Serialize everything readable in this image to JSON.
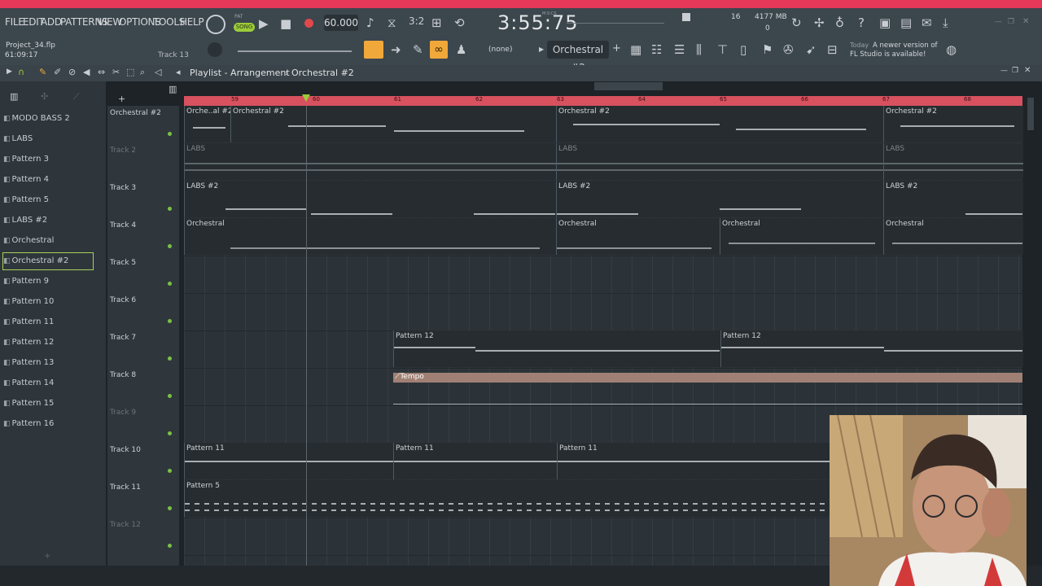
{
  "menu": [
    "FILE",
    "EDIT",
    "ADD",
    "PATTERNS",
    "VIEW",
    "OPTIONS",
    "TOOLS",
    "HELP"
  ],
  "transport": {
    "mode_pat": "PAT",
    "mode_song": "SONG",
    "tempo": "60.000",
    "time": "3:55:75",
    "time_label": "M:S:CS"
  },
  "system": {
    "cpu": "16",
    "memory": "4177 MB",
    "polyphony": "0"
  },
  "project": {
    "file": "Project_34.flp",
    "time": "61:09:17",
    "track_hint": "Track 13"
  },
  "snap": "(none)",
  "pattern_selector": "Orchestral #2",
  "news": {
    "date": "Today",
    "text": "A newer version of FL Studio is available!"
  },
  "playlist": {
    "title": "Playlist - Arrangement",
    "pattern": "Orchestral #2"
  },
  "patterns": [
    "MODO BASS 2",
    "LABS",
    "Pattern 3",
    "Pattern 4",
    "Pattern 5",
    "LABS #2",
    "Orchestral",
    "Orchestral #2",
    "Pattern 9",
    "Pattern 10",
    "Pattern 11",
    "Pattern 12",
    "Pattern 13",
    "Pattern 14",
    "Pattern 15",
    "Pattern 16"
  ],
  "ruler": [
    "59",
    "60",
    "61",
    "62",
    "63",
    "64",
    "65",
    "66",
    "67",
    "68"
  ],
  "tracks": [
    {
      "name": "Orchestral #2",
      "clips": [
        {
          "label": "Orche..al #2"
        },
        {
          "label": "Orchestral #2"
        },
        {
          "label": "Orchestral #2"
        },
        {
          "label": "Orchestral #2"
        }
      ]
    },
    {
      "name": "Track 2",
      "clips": [
        {
          "label": "LABS"
        },
        {
          "label": "LABS"
        },
        {
          "label": "LABS"
        }
      ]
    },
    {
      "name": "Track 3",
      "clips": [
        {
          "label": "LABS #2"
        },
        {
          "label": "LABS #2"
        },
        {
          "label": "LABS #2"
        }
      ]
    },
    {
      "name": "Track 4",
      "clips": [
        {
          "label": "Orchestral"
        },
        {
          "label": "Orchestral"
        },
        {
          "label": "Orchestral"
        },
        {
          "label": "Orchestral"
        }
      ]
    },
    {
      "name": "Track 5",
      "clips": []
    },
    {
      "name": "Track 6",
      "clips": []
    },
    {
      "name": "Track 7",
      "clips": [
        {
          "label": "Pattern 12"
        },
        {
          "label": "Pattern 12"
        }
      ]
    },
    {
      "name": "Track 8",
      "clips": [
        {
          "label": "Tempo"
        }
      ]
    },
    {
      "name": "Track 9",
      "clips": []
    },
    {
      "name": "Track 10",
      "clips": [
        {
          "label": "Pattern 11"
        },
        {
          "label": "Pattern 11"
        },
        {
          "label": "Pattern 11"
        }
      ]
    },
    {
      "name": "Track 11",
      "clips": [
        {
          "label": "Pattern 5"
        }
      ]
    },
    {
      "name": "Track 12",
      "clips": []
    }
  ],
  "colors": {
    "accent": "#e63859",
    "ruler": "#d7515f",
    "led": "#7ac143",
    "tempo_clip": "#a08074",
    "selected_pattern": "#a9cf5b"
  }
}
